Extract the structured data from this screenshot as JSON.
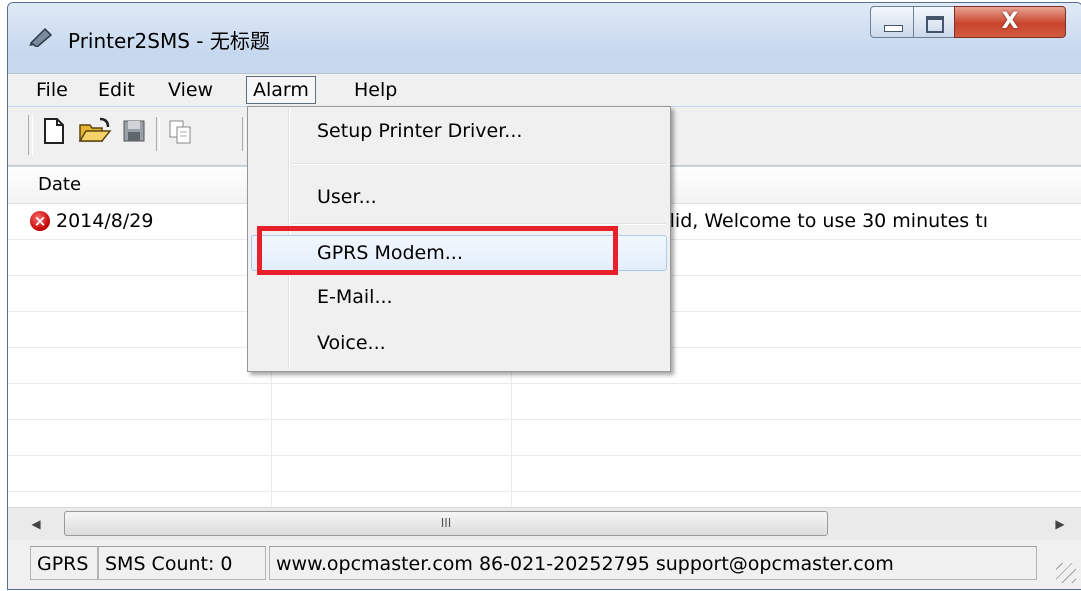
{
  "window": {
    "title": "Printer2SMS - 无标题"
  },
  "menubar": {
    "items": [
      "File",
      "Edit",
      "View",
      "Alarm",
      "Help"
    ]
  },
  "toolbar": {
    "buttons": [
      "new-icon",
      "open-icon",
      "save-icon",
      "copy-icon"
    ]
  },
  "list": {
    "columns": [
      "Date",
      "",
      ""
    ],
    "rows": [
      {
        "date": "2014/8/29",
        "col2": "",
        "message": "alid, Welcome to use 30 minutes tı"
      }
    ]
  },
  "scrollbar": {
    "grip": "III",
    "left_arrow": "◀",
    "right_arrow": "▶"
  },
  "dropdown": {
    "items": [
      "Setup Printer Driver...",
      "User...",
      "GPRS Modem...",
      "E-Mail...",
      "Voice..."
    ]
  },
  "statusbar": {
    "mode": "GPRS",
    "sms_count": "SMS Count: 0",
    "contact": "www.opcmaster.com 86-021-20252795 support@opcmaster.com"
  },
  "colors": {
    "highlight": "#e8202a",
    "error": "#c00000",
    "title_bg": "#c5d7ee"
  }
}
